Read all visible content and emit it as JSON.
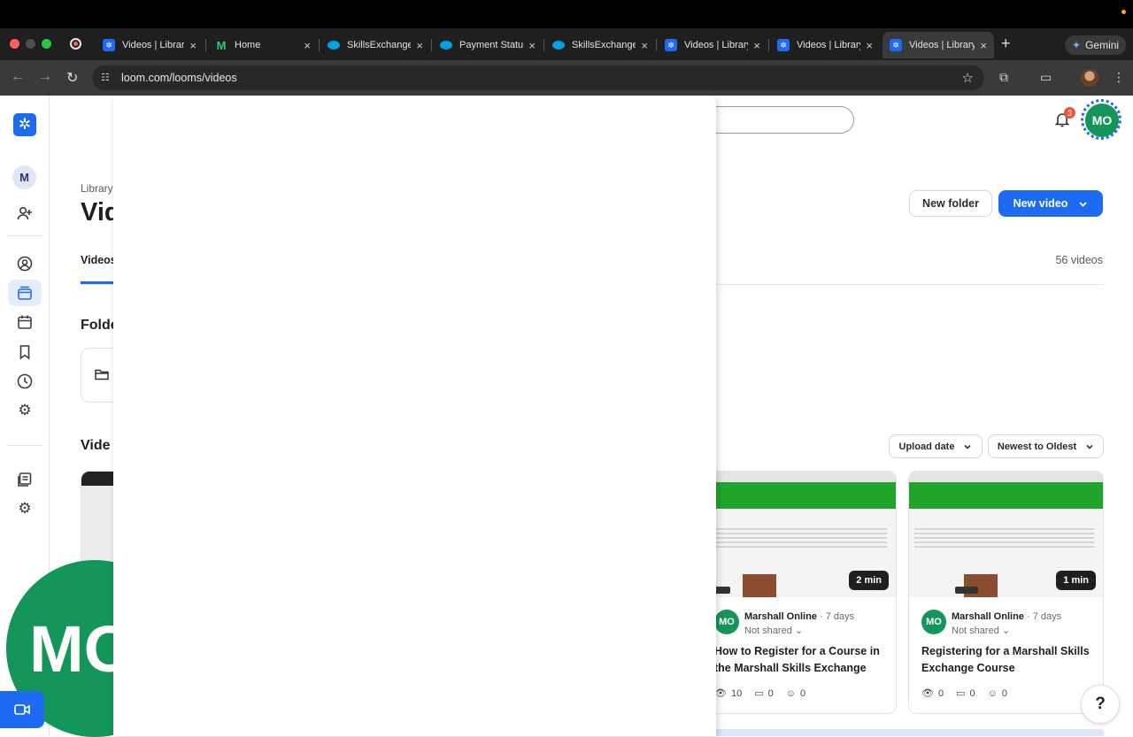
{
  "browser": {
    "tabs": [
      {
        "title": "Videos | Library",
        "favicon": "loom-icon",
        "active": false
      },
      {
        "title": "Home",
        "favicon": "m-icon",
        "active": false
      },
      {
        "title": "SkillsExchange",
        "favicon": "salesforce-icon",
        "active": false
      },
      {
        "title": "Payment Status",
        "favicon": "salesforce-icon",
        "active": false
      },
      {
        "title": "SkillsExchange",
        "favicon": "salesforce-icon",
        "active": false
      },
      {
        "title": "Videos | Library",
        "favicon": "loom-icon",
        "active": false
      },
      {
        "title": "Videos | Library",
        "favicon": "loom-icon",
        "active": false
      },
      {
        "title": "Videos | Library",
        "favicon": "loom-icon",
        "active": true
      }
    ],
    "new_tab": "+",
    "gemini_label": "Gemini",
    "url": "loom.com/looms/videos"
  },
  "header": {
    "notification_count": "3",
    "avatar_initials": "MO"
  },
  "sidebar": {
    "workspace_initial": "M"
  },
  "library": {
    "breadcrumb": "Library",
    "title": "Vid",
    "new_folder_label": "New folder",
    "new_video_label": "New video",
    "tab_label": "Videos",
    "video_count": "56 videos",
    "folders_heading": "Folde",
    "videos_heading": "Vide",
    "sort_field": "Upload date",
    "sort_order": "Newest to Oldest"
  },
  "videos": [
    {
      "duration": "2 min",
      "owner_initials": "MO",
      "owner": "Marshall Online",
      "age": "7 days",
      "sharing": "Not shared",
      "title": "How to Register for a Course in the Marshall Skills Exchange",
      "views": "10",
      "comments": "0",
      "reactions": "0"
    },
    {
      "duration": "1 min",
      "owner_initials": "MO",
      "owner": "Marshall Online",
      "age": "7 days",
      "sharing": "Not shared",
      "title": "Registering for a Marshall Skills Exchange Course",
      "views": "0",
      "comments": "0",
      "reactions": "0"
    }
  ],
  "help_label": "?",
  "bubble_initials": "MO",
  "colors": {
    "accent": "#1d6bf3",
    "avatar_green": "#14955a",
    "thumbnail_green": "#1fa52a"
  }
}
